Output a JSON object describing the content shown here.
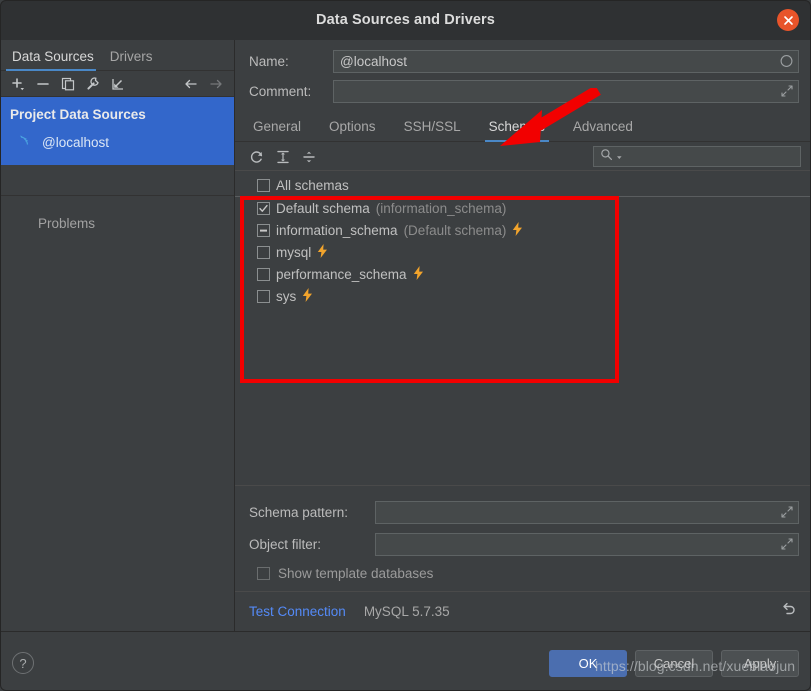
{
  "window": {
    "title": "Data Sources and Drivers",
    "close_icon": "close-icon"
  },
  "sidebar": {
    "tabs": [
      {
        "label": "Data Sources",
        "active": true
      },
      {
        "label": "Drivers",
        "active": false
      }
    ],
    "toolbar": [
      {
        "name": "add-icon",
        "glyph": "+"
      },
      {
        "name": "remove-icon",
        "glyph": "−"
      },
      {
        "name": "copy-icon",
        "glyph": "copy"
      },
      {
        "name": "wrench-icon",
        "glyph": "wrench"
      },
      {
        "name": "import-icon",
        "glyph": "import"
      },
      {
        "name": "back-arrow-icon",
        "glyph": "←"
      },
      {
        "name": "forward-arrow-icon",
        "glyph": "→"
      }
    ],
    "group_title": "Project Data Sources",
    "items": [
      {
        "label": "@localhost",
        "icon": "mysql-dolphin-icon",
        "selected": true
      }
    ],
    "problems_label": "Problems"
  },
  "form": {
    "name_label": "Name:",
    "name_value": "@localhost",
    "comment_label": "Comment:",
    "comment_value": "",
    "comment_placeholder": ""
  },
  "tabs": [
    {
      "label": "General",
      "active": false
    },
    {
      "label": "Options",
      "active": false
    },
    {
      "label": "SSH/SSL",
      "active": false
    },
    {
      "label": "Schemas",
      "active": true
    },
    {
      "label": "Advanced",
      "active": false
    }
  ],
  "schemas_toolbar": {
    "refresh_icon": "refresh-icon",
    "expand_all_icon": "expand-all-icon",
    "collapse_all_icon": "collapse-all-icon",
    "search_placeholder": "",
    "search_value": "",
    "search_icon": "search-icon"
  },
  "schema_list": [
    {
      "label": "All schemas",
      "hint": "",
      "state": "unchecked",
      "bolt": false,
      "divider": true
    },
    {
      "label": "Default schema",
      "hint": "(information_schema)",
      "state": "checked",
      "bolt": false,
      "divider": false
    },
    {
      "label": "information_schema",
      "hint": "(Default schema)",
      "state": "partial",
      "bolt": true,
      "divider": false
    },
    {
      "label": "mysql",
      "hint": "",
      "state": "unchecked",
      "bolt": true,
      "divider": false
    },
    {
      "label": "performance_schema",
      "hint": "",
      "state": "unchecked",
      "bolt": true,
      "divider": false
    },
    {
      "label": "sys",
      "hint": "",
      "state": "unchecked",
      "bolt": true,
      "divider": false
    }
  ],
  "bottom_form": {
    "schema_pattern_label": "Schema pattern:",
    "schema_pattern_value": "",
    "object_filter_label": "Object filter:",
    "object_filter_value": "",
    "show_template_label": "Show template databases",
    "show_template_checked": false,
    "expand_icon": "expand-editor-icon"
  },
  "test_row": {
    "test_connection_label": "Test Connection",
    "db_version": "MySQL 5.7.35",
    "revert_icon": "revert-icon"
  },
  "footer": {
    "help_label": "?",
    "buttons": [
      {
        "label": "OK",
        "primary": true
      },
      {
        "label": "Cancel",
        "primary": false
      },
      {
        "label": "Apply",
        "primary": false
      }
    ]
  },
  "annotations": {
    "watermark": "https://blog.csdn.net/xueblaojun",
    "highlight_color": "#f20000",
    "arrow_target": "Schemas"
  },
  "colors": {
    "accent": "#4a88c7",
    "selection": "#3367cb",
    "primary_button": "#4b6eaf",
    "bolt": "#f2a42c",
    "link": "#548af7",
    "close": "#e8542a"
  }
}
